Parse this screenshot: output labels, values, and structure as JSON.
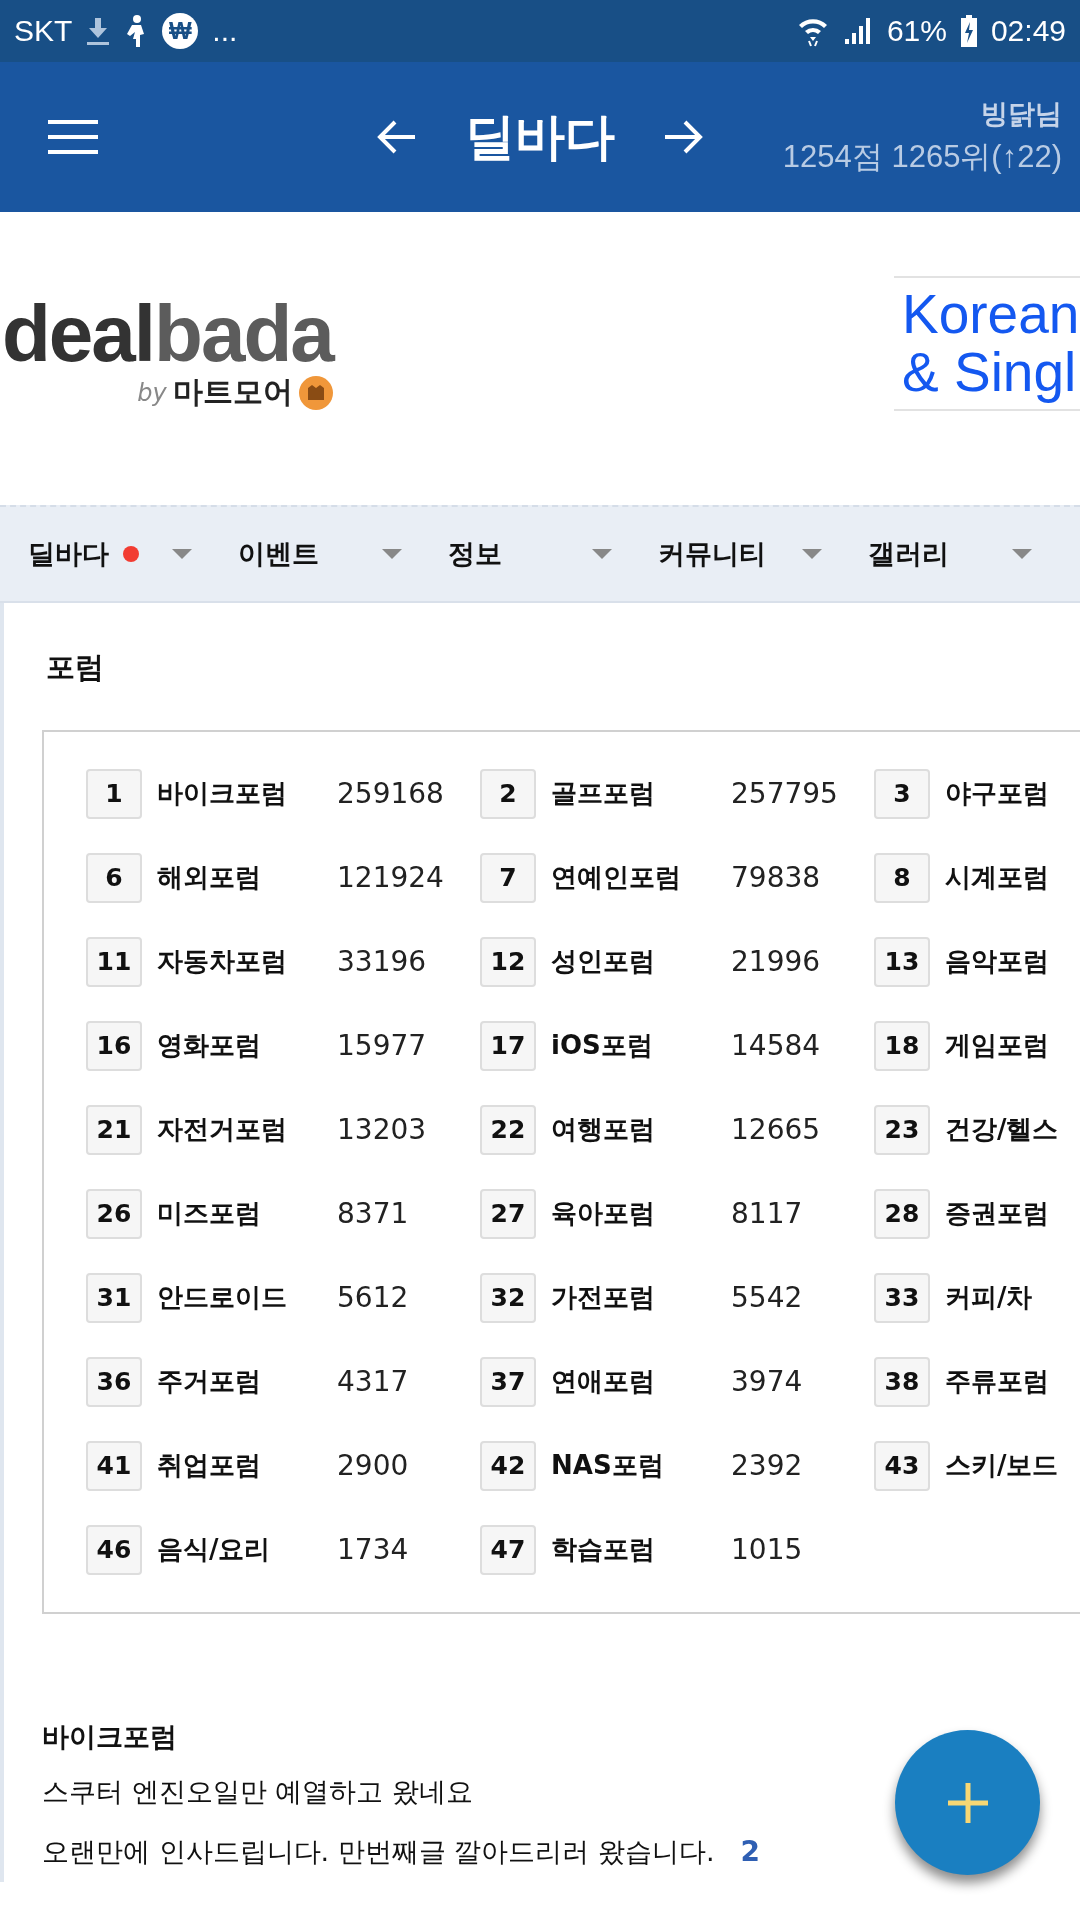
{
  "status_bar": {
    "carrier": "SKT",
    "won_symbol": "₩",
    "more": "...",
    "battery": "61%",
    "time": "02:49"
  },
  "header": {
    "title": "딜바다",
    "user": "빙닭님",
    "score": "1254점 1265위(↑22)"
  },
  "logo": {
    "wordmark_dark": "deal",
    "wordmark_light": "bada",
    "by": "by",
    "brand": "마트모어"
  },
  "banner": {
    "lines": [
      "Korean",
      "& Singl"
    ]
  },
  "nav": [
    {
      "label": "딜바다",
      "new": true
    },
    {
      "label": "이벤트",
      "new": false
    },
    {
      "label": "정보",
      "new": false
    },
    {
      "label": "커뮤니티",
      "new": false
    },
    {
      "label": "갤러리",
      "new": false
    }
  ],
  "forum": {
    "title": "포럼",
    "rows": [
      [
        {
          "rank": "1",
          "name": "바이크포럼",
          "count": "259168"
        },
        {
          "rank": "2",
          "name": "골프포럼",
          "count": "257795"
        },
        {
          "rank": "3",
          "name": "야구포럼"
        }
      ],
      [
        {
          "rank": "6",
          "name": "해외포럼",
          "count": "121924"
        },
        {
          "rank": "7",
          "name": "연예인포럼",
          "count": "79838"
        },
        {
          "rank": "8",
          "name": "시계포럼"
        }
      ],
      [
        {
          "rank": "11",
          "name": "자동차포럼",
          "count": "33196"
        },
        {
          "rank": "12",
          "name": "성인포럼",
          "count": "21996"
        },
        {
          "rank": "13",
          "name": "음악포럼"
        }
      ],
      [
        {
          "rank": "16",
          "name": "영화포럼",
          "count": "15977"
        },
        {
          "rank": "17",
          "name": "iOS포럼",
          "count": "14584"
        },
        {
          "rank": "18",
          "name": "게임포럼"
        }
      ],
      [
        {
          "rank": "21",
          "name": "자전거포럼",
          "count": "13203"
        },
        {
          "rank": "22",
          "name": "여행포럼",
          "count": "12665"
        },
        {
          "rank": "23",
          "name": "건강/헬스"
        }
      ],
      [
        {
          "rank": "26",
          "name": "미즈포럼",
          "count": "8371"
        },
        {
          "rank": "27",
          "name": "육아포럼",
          "count": "8117"
        },
        {
          "rank": "28",
          "name": "증권포럼"
        }
      ],
      [
        {
          "rank": "31",
          "name": "안드로이드",
          "count": "5612"
        },
        {
          "rank": "32",
          "name": "가전포럼",
          "count": "5542"
        },
        {
          "rank": "33",
          "name": "커피/차"
        }
      ],
      [
        {
          "rank": "36",
          "name": "주거포럼",
          "count": "4317"
        },
        {
          "rank": "37",
          "name": "연애포럼",
          "count": "3974"
        },
        {
          "rank": "38",
          "name": "주류포럼"
        }
      ],
      [
        {
          "rank": "41",
          "name": "취업포럼",
          "count": "2900"
        },
        {
          "rank": "42",
          "name": "NAS포럼",
          "count": "2392"
        },
        {
          "rank": "43",
          "name": "스키/보드"
        }
      ],
      [
        {
          "rank": "46",
          "name": "음식/요리",
          "count": "1734"
        },
        {
          "rank": "47",
          "name": "학습포럼",
          "count": "1015"
        }
      ]
    ]
  },
  "board": {
    "title": "바이크포럼",
    "posts": [
      {
        "title": "스쿠터 엔진오일만 예열하고 왔네요"
      },
      {
        "title": "오랜만에 인사드립니다. 만번째글 깔아드리러 왔습니다.",
        "comments": "2"
      }
    ]
  }
}
